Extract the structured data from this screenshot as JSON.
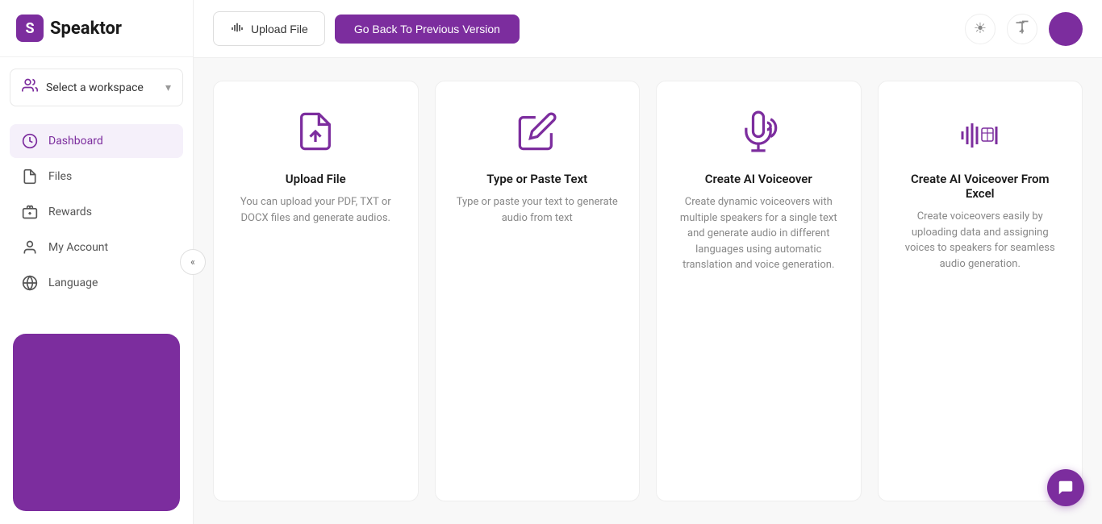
{
  "sidebar": {
    "logo": {
      "icon_letter": "S",
      "text": "Speaktor"
    },
    "workspace": {
      "label": "Select a workspace",
      "chevron": "▾"
    },
    "nav": [
      {
        "id": "dashboard",
        "label": "Dashboard",
        "icon": "dashboard",
        "active": true
      },
      {
        "id": "files",
        "label": "Files",
        "icon": "files"
      },
      {
        "id": "rewards",
        "label": "Rewards",
        "icon": "rewards"
      },
      {
        "id": "my-account",
        "label": "My Account",
        "icon": "account"
      },
      {
        "id": "language",
        "label": "Language",
        "icon": "language"
      }
    ],
    "collapse_icon": "«"
  },
  "topbar": {
    "upload_label": "Upload File",
    "go_back_label": "Go Back To Previous Version",
    "theme_icon": "☀",
    "translate_icon": "A"
  },
  "cards": [
    {
      "id": "upload-file",
      "title": "Upload File",
      "desc": "You can upload your PDF, TXT or DOCX files and generate audios.",
      "icon": "upload-file"
    },
    {
      "id": "type-paste",
      "title": "Type or Paste Text",
      "desc": "Type or paste your text to generate audio from text",
      "icon": "type-paste"
    },
    {
      "id": "ai-voiceover",
      "title": "Create AI Voiceover",
      "desc": "Create dynamic voiceovers with multiple speakers for a single text and generate audio in different languages using automatic translation and voice generation.",
      "icon": "ai-voiceover"
    },
    {
      "id": "ai-voiceover-excel",
      "title": "Create AI Voiceover From Excel",
      "desc": "Create voiceovers easily by uploading data and assigning voices to speakers for seamless audio generation.",
      "icon": "ai-voiceover-excel"
    }
  ],
  "colors": {
    "brand": "#7c2d9e",
    "brand_light": "#f5f0fa"
  }
}
